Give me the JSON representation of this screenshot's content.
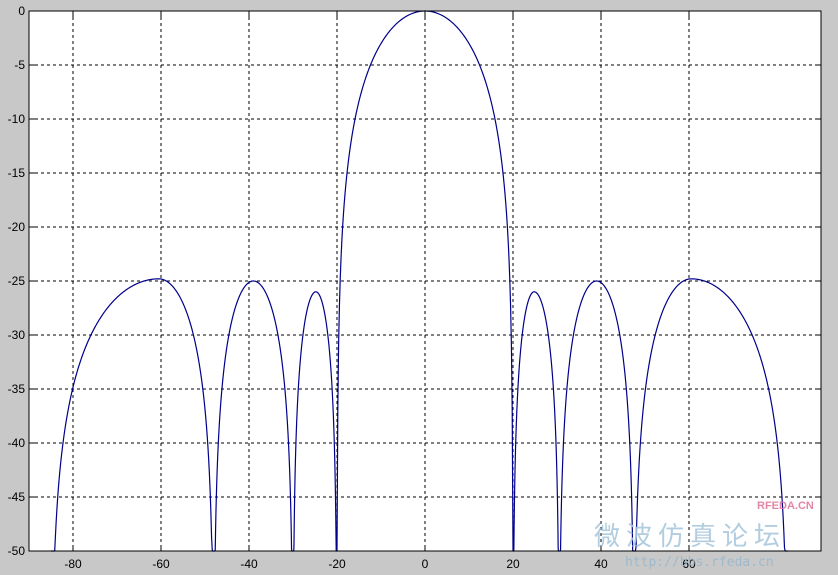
{
  "chart_data": {
    "type": "line",
    "title": "",
    "xlabel": "",
    "ylabel": "",
    "xlim": [
      -90,
      90
    ],
    "ylim": [
      -50,
      0
    ],
    "grid": true,
    "xticks": [
      -80,
      -60,
      -40,
      -20,
      0,
      20,
      40,
      60
    ],
    "yticks": [
      0,
      -5,
      -10,
      -15,
      -20,
      -25,
      -30,
      -35,
      -40,
      -45,
      -50
    ],
    "xtick_labels": [
      "-80",
      "-60",
      "-40",
      "-20",
      "0",
      "20",
      "40",
      "60"
    ],
    "ytick_labels": [
      "0",
      "-5",
      "-10",
      "-15",
      "-20",
      "-25",
      "-30",
      "-35",
      "-40",
      "-45",
      "-50"
    ],
    "line_color": "#00008b",
    "grid_color": "#000000",
    "plot_background": "#ffffff",
    "figure_background": "#c8c8c8",
    "series": [
      {
        "lobes": [
          {
            "from": -85,
            "to": -48,
            "peak_x": -60.5,
            "peak_y": -24.8
          },
          {
            "from": -48,
            "to": -30,
            "peak_x": -39,
            "peak_y": -25
          },
          {
            "from": -30,
            "to": -20,
            "peak_x": -24.8,
            "peak_y": -26
          },
          {
            "from": -20,
            "to": 20,
            "peak_x": 0,
            "peak_y": 0
          },
          {
            "from": 20,
            "to": 30.5,
            "peak_x": 24.8,
            "peak_y": -26
          },
          {
            "from": 30.5,
            "to": 47.5,
            "peak_x": 39,
            "peak_y": -25
          },
          {
            "from": 47.5,
            "to": 82.5,
            "peak_x": 60.5,
            "peak_y": -24.8
          }
        ]
      }
    ]
  },
  "watermark": {
    "logo_text": "RFEDA.CN",
    "cn_text": "微波仿真论坛",
    "url_text": "http://bbs.rfeda.cn"
  }
}
